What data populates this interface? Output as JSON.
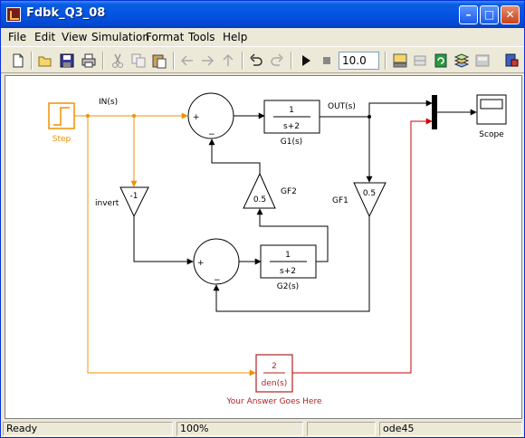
{
  "window": {
    "title": "Fdbk_Q3_08"
  },
  "menu": [
    "File",
    "Edit",
    "View",
    "Simulation",
    "Format",
    "Tools",
    "Help"
  ],
  "toolbar": {
    "stop_time": "10.0"
  },
  "blocks": {
    "step": {
      "label": "Step"
    },
    "sum1": {
      "plus": "+",
      "minus": "−"
    },
    "sum2": {
      "plus": "+",
      "minus": "−"
    },
    "g1": {
      "num": "1",
      "den": "s+2",
      "label": "G1(s)"
    },
    "g2": {
      "num": "1",
      "den": "s+2",
      "label": "G2(s)"
    },
    "gf1": {
      "gain": "0.5",
      "label": "GF1"
    },
    "gf2": {
      "gain": "0.5",
      "label": "GF2"
    },
    "invert": {
      "gain": "-1",
      "label": "invert"
    },
    "answer": {
      "num": "2",
      "den": "den(s)",
      "label": "Your Answer Goes Here"
    },
    "scope": {
      "label": "Scope"
    }
  },
  "signals": {
    "in": "IN(s)",
    "out": "OUT(s)"
  },
  "colors": {
    "orange": "#f09000",
    "red": "#cc0000",
    "black": "#000000",
    "answer_red": "#b22222"
  },
  "status": {
    "state": "Ready",
    "zoom": "100%",
    "solver": "ode45"
  }
}
